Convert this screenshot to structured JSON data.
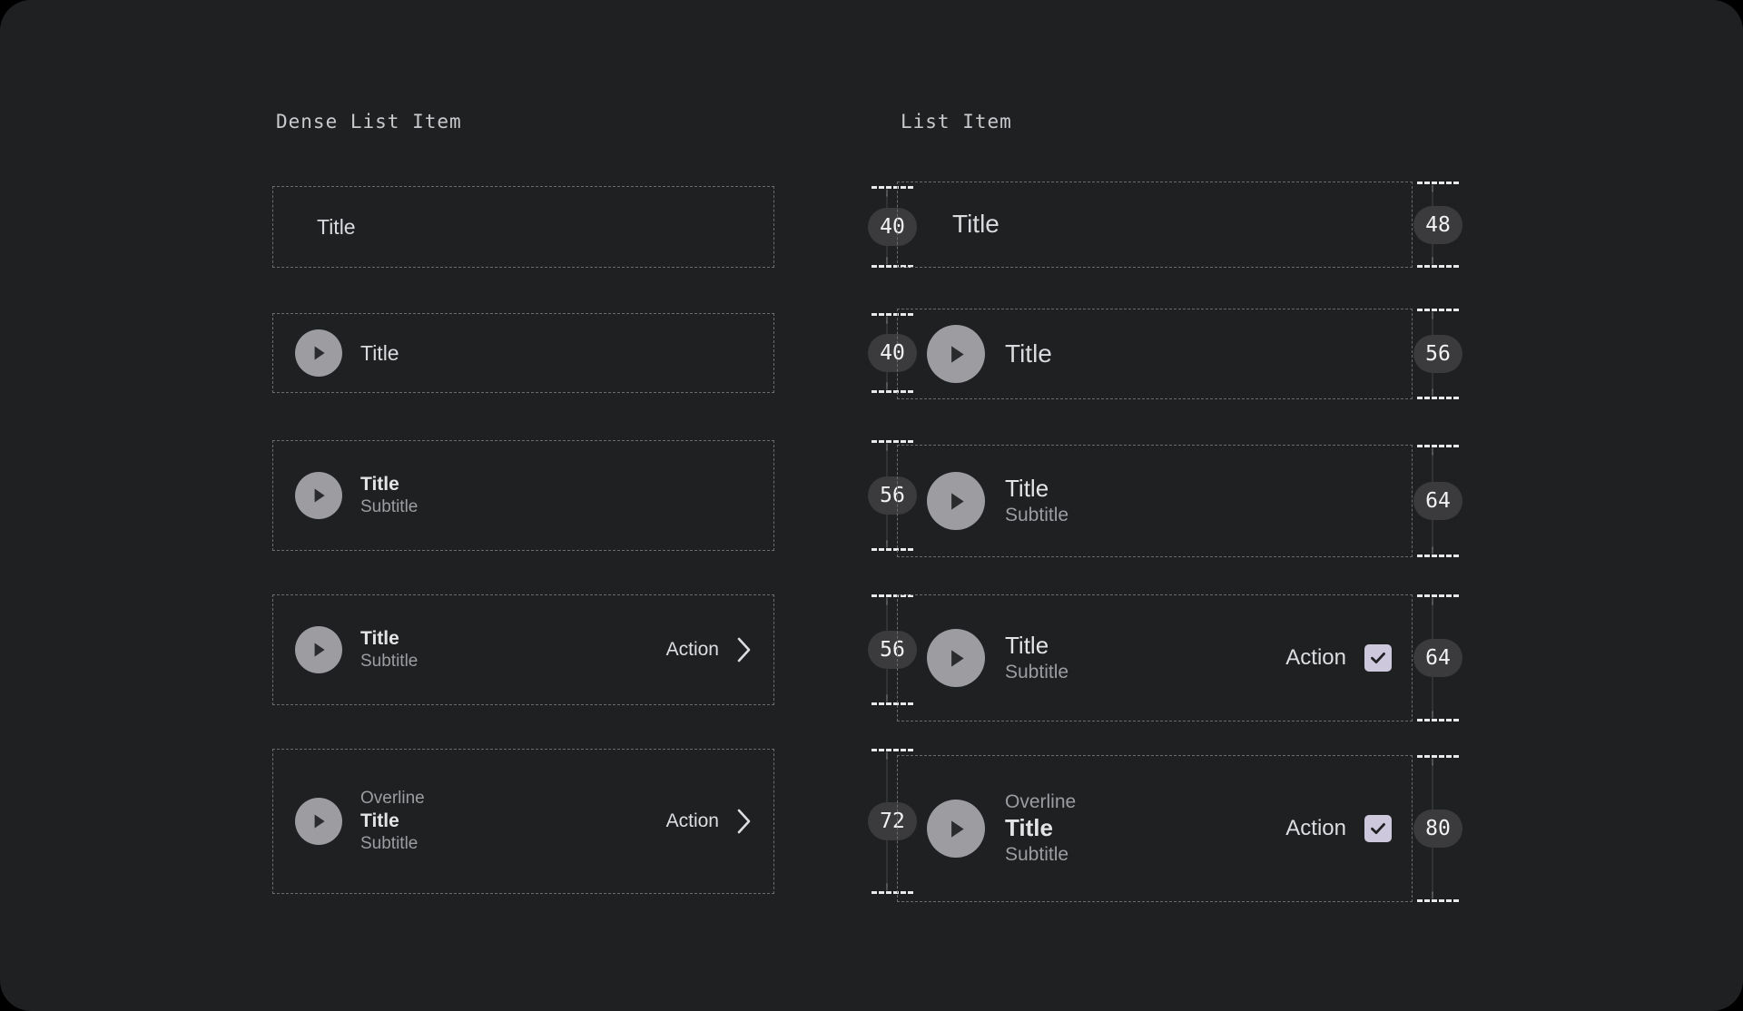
{
  "app": {
    "background": "#000000",
    "card_background": "#1E2022"
  },
  "colors": {
    "title": "#E3E4E6",
    "secondary_text": "#9B9DA1",
    "avatar": "#9C9CA1",
    "checkbox": "#CEC8DC",
    "badge_background": "#3B3B3D",
    "guide_dash": "#6A6C70",
    "gauge_dash": "#E8E9EB"
  },
  "columns": [
    {
      "key": "dense",
      "header": "Dense List Item",
      "rows": [
        {
          "height_label": "40",
          "overline": null,
          "title": "Title",
          "subtitle": null,
          "avatar_icon": null,
          "action_label": null,
          "action_icon": null
        },
        {
          "height_label": "40",
          "overline": null,
          "title": "Title",
          "subtitle": null,
          "avatar_icon": "play-circle-icon",
          "action_label": null,
          "action_icon": null
        },
        {
          "height_label": "56",
          "overline": null,
          "title": "Title",
          "subtitle": "Subtitle",
          "avatar_icon": "play-circle-icon",
          "action_label": null,
          "action_icon": null
        },
        {
          "height_label": "56",
          "overline": null,
          "title": "Title",
          "subtitle": "Subtitle",
          "avatar_icon": "play-circle-icon",
          "action_label": "Action",
          "action_icon": "chevron-right-icon"
        },
        {
          "height_label": "72",
          "overline": "Overline",
          "title": "Title",
          "subtitle": "Subtitle",
          "avatar_icon": "play-circle-icon",
          "action_label": "Action",
          "action_icon": "chevron-right-icon"
        }
      ]
    },
    {
      "key": "regular",
      "header": "List Item",
      "rows": [
        {
          "height_label": "48",
          "overline": null,
          "title": "Title",
          "subtitle": null,
          "avatar_icon": null,
          "action_label": null,
          "action_icon": null
        },
        {
          "height_label": "56",
          "overline": null,
          "title": "Title",
          "subtitle": null,
          "avatar_icon": "play-circle-icon",
          "action_label": null,
          "action_icon": null
        },
        {
          "height_label": "64",
          "overline": null,
          "title": "Title",
          "subtitle": "Subtitle",
          "avatar_icon": "play-circle-icon",
          "action_label": null,
          "action_icon": null
        },
        {
          "height_label": "64",
          "overline": null,
          "title": "Title",
          "subtitle": "Subtitle",
          "avatar_icon": "play-circle-icon",
          "action_label": "Action",
          "action_icon": "checkbox-checked-icon"
        },
        {
          "height_label": "80",
          "overline": "Overline",
          "title": "Title",
          "subtitle": "Subtitle",
          "avatar_icon": "play-circle-icon",
          "action_label": "Action",
          "action_icon": "checkbox-checked-icon"
        }
      ]
    }
  ]
}
